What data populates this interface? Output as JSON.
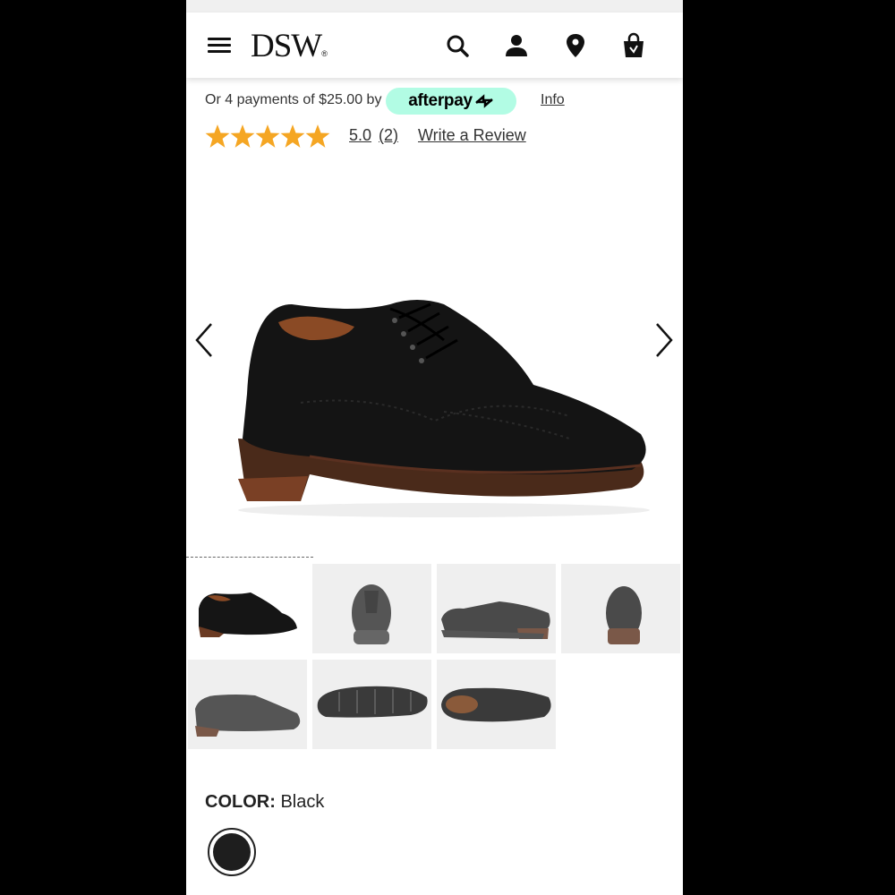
{
  "header": {
    "logo_text": "DSW",
    "logo_mark": "®",
    "icons": [
      "menu-icon",
      "search-icon",
      "account-icon",
      "location-icon",
      "bag-icon"
    ]
  },
  "afterpay": {
    "text": "Or 4 payments of $25.00 by",
    "brand": "afterpay",
    "info_label": "Info",
    "badge_color": "#b2fce4"
  },
  "rating": {
    "stars": 5,
    "value": "5.0",
    "count": "(2)",
    "write_review_label": "Write a Review",
    "star_color": "#f5a623"
  },
  "gallery": {
    "thumbnails": [
      "side view",
      "front view",
      "side view",
      "back view",
      "outer side view",
      "sole view",
      "top view"
    ],
    "active_index": 0
  },
  "color": {
    "label": "COLOR:",
    "value": "Black",
    "swatch_color": "#1e1e1e"
  }
}
